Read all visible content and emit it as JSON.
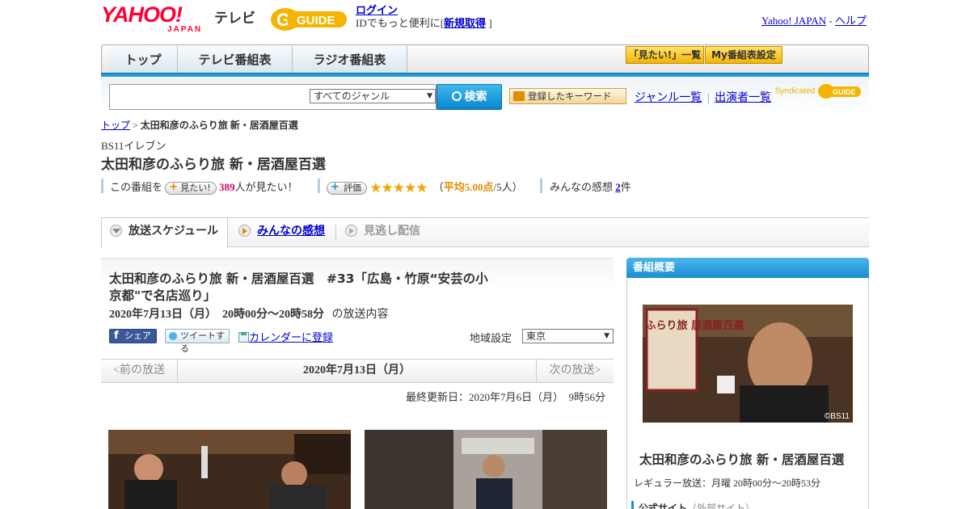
{
  "header": {
    "logo_text": "YAHOO!",
    "logo_sub": "JAPAN",
    "tv_label": "テレビ",
    "gguide_label": "GUIDE",
    "login_label": "ログイン",
    "login_prompt": "IDでもっと便利に[",
    "signup_label": "新規取得",
    "login_prompt_end": "]",
    "yahoo_japan_link": "Yahoo! JAPAN",
    "separator": "-",
    "help_link": "ヘルプ"
  },
  "nav": {
    "tabs": [
      "トップ",
      "テレビ番組表",
      "ラジオ番組表"
    ],
    "want_list_label": "「見たい!」一覧",
    "my_schedule_label": "My番組表設定"
  },
  "search": {
    "placeholder": "",
    "genre_selected": "すべてのジャンル",
    "search_button": "検索",
    "keyword_button": "登録したキーワード",
    "genre_list_link": "ジャンル一覧",
    "performer_list_link": "出演者一覧",
    "divider": "|",
    "syndicated_label": "Syndicated"
  },
  "breadcrumb": {
    "top": "トップ",
    "sep": ">",
    "current": "太田和彦のふらり旅 新・居酒屋百選"
  },
  "program": {
    "channel": "BS11イレブン",
    "title": "太田和彦のふらり旅 新・居酒屋百選",
    "want_prefix": "この番組を",
    "want_button": "見たい!",
    "want_count": "389",
    "want_suffix": "人が見たい！",
    "rating_button": "評価",
    "stars": "★★★★★",
    "rating_open": "（",
    "rating_avg": "平均5.00点",
    "rating_count": "/5人）",
    "impressions_prefix": "みんなの感想",
    "impressions_count": "2",
    "impressions_suffix": "件"
  },
  "tabs": {
    "schedule": "放送スケジュール",
    "impressions": "みんなの感想",
    "missed": "見逃し配信"
  },
  "episode": {
    "title": "太田和彦のふらり旅 新・居酒屋百選　#33「広島・竹原“安芸の小京都\"で名店巡り」",
    "datetime": "2020年7月13日（月）　20時00分～20時58分",
    "datetime_suffix": "の放送内容",
    "share_button": "シェア",
    "tweet_button": "ツイートする",
    "calendar_link": "カレンダーに登録",
    "region_label": "地域設定",
    "region_selected": "東京",
    "prev_label": "<前の放送",
    "current_date": "2020年7月13日（月）",
    "next_label": "次の放送>",
    "updated": "最終更新日：2020年7月6日（月）　9時56分"
  },
  "sidebar": {
    "header": "番組概要",
    "image_credit": "©BS11",
    "image_title_text": "太田和彦 ふらり旅 居酒屋百選",
    "title": "太田和彦のふらり旅 新・居酒屋百選",
    "regular": "レギュラー放送：月曜 20時00分～20時53分",
    "official_label": "公式サイト",
    "official_note": "（外部サイト）"
  },
  "colors": {
    "accent_blue": "#1a8ed1",
    "yahoo_red": "#ff0033",
    "star_orange": "#f0a500",
    "link_blue": "#0000cc"
  }
}
